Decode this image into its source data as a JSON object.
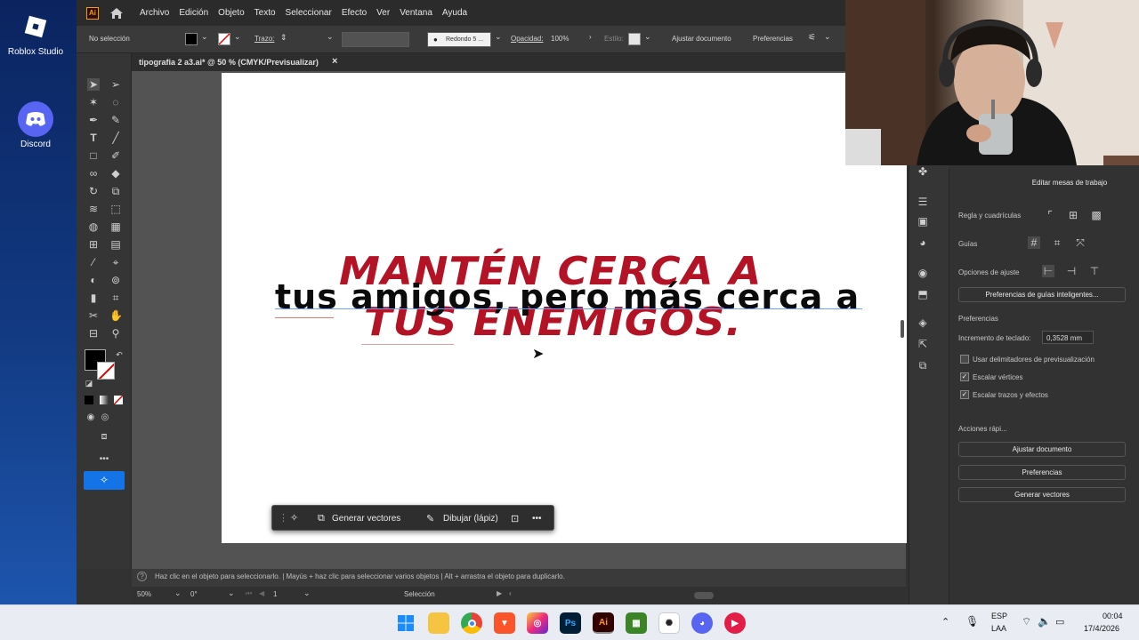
{
  "desktop": {
    "icons": [
      {
        "label": "Roblox Studio",
        "icon": "roblox-icon"
      },
      {
        "label": "Discord",
        "icon": "discord-icon"
      }
    ]
  },
  "app": {
    "logo": "Ai",
    "menu": [
      "Archivo",
      "Edición",
      "Objeto",
      "Texto",
      "Seleccionar",
      "Efecto",
      "Ver",
      "Ventana",
      "Ayuda"
    ]
  },
  "control_bar": {
    "selection": "No selección",
    "stroke_label": "Trazo:",
    "brush": "Redondo 5 ...",
    "opacity_label": "Opacidad:",
    "opacity_value": "100%",
    "style_label": "Estilo:",
    "adjust_doc": "Ajustar documento",
    "preferences": "Preferencias"
  },
  "document": {
    "tab": "tipografia 2 a3.ai* @ 50 % (CMYK/Previsualizar)",
    "close": "×",
    "red_line_1": "MANTÉN CERCA A",
    "black_line": "tus amigos, pero más cerca a",
    "red_line_2": "TUS ENEMIGOS."
  },
  "context_bar": {
    "generate": "Generar vectores",
    "draw": "Dibujar (lápiz)",
    "more": "•••"
  },
  "status": {
    "hint": "Haz clic en el objeto para seleccionarlo.  |  Mayús + haz clic para seleccionar varios objetos  |  Alt + arrastra el objeto para duplicarlo.",
    "zoom": "50%",
    "rotation": "0°",
    "artboard_num": "1",
    "tool": "Selección"
  },
  "right_panel": {
    "edit_artboards": "Editar mesas de trabajo",
    "rulers_grids": "Regla y cuadrículas",
    "guides": "Guías",
    "snap_options": "Opciones de ajuste",
    "smart_guides_btn": "Preferencias de guías inteligentes...",
    "prefs_header": "Preferencias",
    "keyboard_inc_label": "Incremento de teclado:",
    "keyboard_inc_value": "0,3528 mm",
    "use_preview_bounds": "Usar delimitadores de previsualización",
    "scale_corners": "Escalar vértices",
    "scale_strokes": "Escalar trazos y efectos",
    "quick_actions": "Acciones rápi...",
    "btn_adjust": "Ajustar documento",
    "btn_prefs": "Preferencias",
    "btn_generate": "Generar vectores"
  },
  "taskbar": {
    "lang": "ESP",
    "lang2": "LAA",
    "time": "00:04",
    "date": "17/4/2026"
  },
  "colors": {
    "accent_red": "#b31325",
    "app_bg": "#323232",
    "artboard": "#ffffff"
  }
}
